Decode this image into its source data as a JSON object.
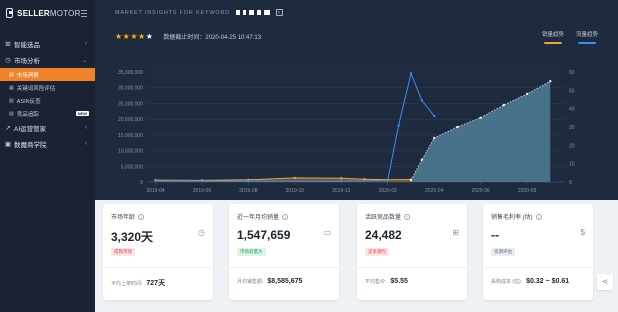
{
  "brand": {
    "name_bold": "SELLER",
    "name_light": "MOTOR"
  },
  "sidebar": {
    "items": [
      {
        "label": "智能选品",
        "icon": "selection-icon",
        "chevron": "‹"
      },
      {
        "label": "市场分析",
        "icon": "trend-icon",
        "chevron": "⌄"
      }
    ],
    "subitems": [
      {
        "label": "市场洞察",
        "active": true
      },
      {
        "label": "关键词风险评估",
        "active": false
      },
      {
        "label": "ASIN反查",
        "active": false
      },
      {
        "label": "竞品追踪",
        "active": false,
        "badge": "NEW"
      }
    ],
    "items_after": [
      {
        "label": "AI运营管家",
        "icon": "ai-icon",
        "chevron": "‹"
      },
      {
        "label": "数魔商学院",
        "icon": "school-icon",
        "chevron": "‹"
      }
    ]
  },
  "header": {
    "title": "MARKET INSIGHTS FOR KEYWORD",
    "rating": {
      "stars": 3.5,
      "max": 5
    },
    "data_time_label": "数据截止时间：2020-04-25 10:47:13",
    "legend": [
      {
        "label": "销量趋势",
        "color": "#f0a23a"
      },
      {
        "label": "流量趋势",
        "color": "#3f8ef5"
      }
    ]
  },
  "chart_data": {
    "type": "line",
    "x": [
      "2019-04",
      "2019-06",
      "2019-08",
      "2019-10",
      "2019-12",
      "2020-02",
      "2020-04",
      "2020-06",
      "2020-08"
    ],
    "left_axis": {
      "ticks": [
        "35,000,000",
        "30,000,000",
        "25,000,000",
        "20,000,000",
        "15,000,000",
        "10,000,000",
        "5,000,000",
        "0"
      ],
      "ylim": [
        0,
        35000000
      ]
    },
    "right_axis": {
      "ticks": [
        "60",
        "50",
        "40",
        "30",
        "20",
        "10",
        "0"
      ],
      "ylim": [
        0,
        60
      ]
    },
    "series": [
      {
        "name": "销量趋势",
        "color": "#f0a23a",
        "axis": "left",
        "points": [
          [
            "2019-04",
            600000
          ],
          [
            "2019-06",
            500000
          ],
          [
            "2019-08",
            700000
          ],
          [
            "2019-10",
            1300000
          ],
          [
            "2019-12",
            1200000
          ],
          [
            "2020-01",
            900000
          ],
          [
            "2020-02",
            700000
          ],
          [
            "2020-03",
            800000
          ]
        ]
      },
      {
        "name": "流量趋势",
        "color": "#3f8ef5",
        "axis": "left",
        "points": [
          [
            "2019-04",
            400000
          ],
          [
            "2019-08",
            300000
          ],
          [
            "2019-12",
            300000
          ],
          [
            "2020-02",
            500000
          ],
          [
            "2020-02-15",
            18000000
          ],
          [
            "2020-03",
            34500000
          ],
          [
            "2020-03-15",
            26000000
          ],
          [
            "2020-04",
            21000000
          ]
        ]
      },
      {
        "name": "",
        "color": "#4f7f97",
        "axis": "right",
        "area": true,
        "points": [
          [
            "2020-03",
            1
          ],
          [
            "2020-03-15",
            12
          ],
          [
            "2020-04",
            24
          ],
          [
            "2020-05",
            30
          ],
          [
            "2020-06",
            35
          ],
          [
            "2020-07",
            42
          ],
          [
            "2020-08",
            48
          ],
          [
            "2020-09",
            55
          ]
        ]
      }
    ]
  },
  "cards": [
    {
      "title": "市场年龄",
      "value": "3,320天",
      "badge": "成熟市场",
      "badge_color": "red",
      "foot_label": "平均上架时间:",
      "foot_value": "727天",
      "icon": "clock-icon"
    },
    {
      "title": "近一年月均销量",
      "value": "1,547,659",
      "badge": "市场容量大",
      "badge_color": "green",
      "foot_label": "月均销售额:",
      "foot_value": "$8,585,675",
      "icon": "calendar-icon"
    },
    {
      "title": "活跃竞品数量",
      "value": "24,482",
      "badge": "竞争激烈",
      "badge_color": "red",
      "foot_label": "平均售价:",
      "foot_value": "$5.55",
      "icon": "grid-icon"
    },
    {
      "title": "销售毛利率 (估)",
      "value": "--",
      "badge": "资源评估",
      "badge_color": "gray",
      "foot_label": "采购成本 (估):",
      "foot_value": "$0.32 ~ $0.61",
      "icon": "dollar-icon"
    }
  ]
}
